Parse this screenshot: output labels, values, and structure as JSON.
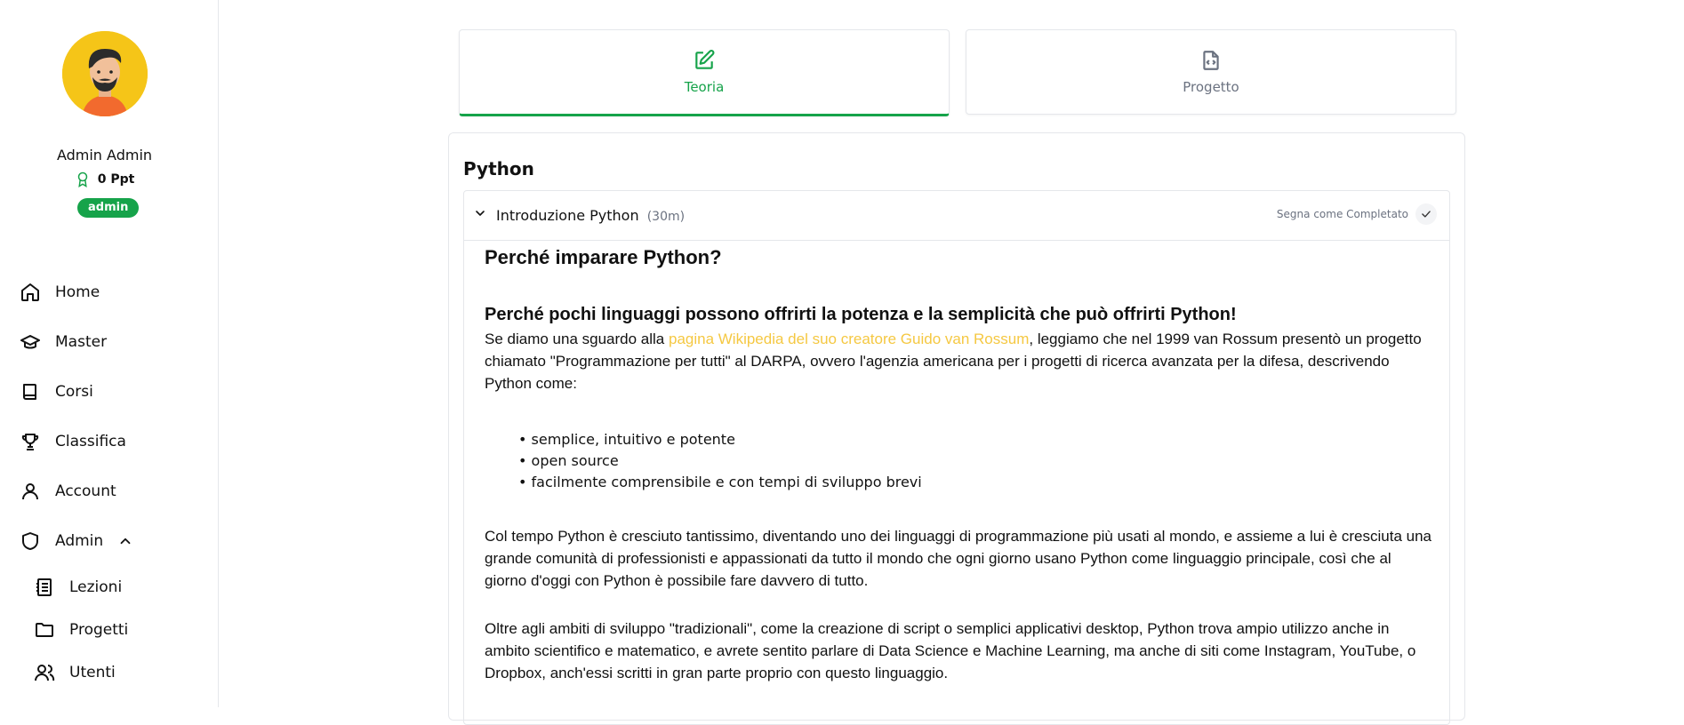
{
  "user": {
    "name": "Admin Admin",
    "points": "0 Ppt",
    "role": "admin"
  },
  "sidebar": {
    "items": [
      {
        "label": "Home",
        "icon": "home-icon"
      },
      {
        "label": "Master",
        "icon": "graduation-cap-icon"
      },
      {
        "label": "Corsi",
        "icon": "book-icon"
      },
      {
        "label": "Classifica",
        "icon": "trophy-icon"
      },
      {
        "label": "Account",
        "icon": "user-icon"
      },
      {
        "label": "Admin",
        "icon": "shield-icon"
      }
    ],
    "admin_subitems": [
      {
        "label": "Lezioni",
        "icon": "list-icon"
      },
      {
        "label": "Progetti",
        "icon": "folder-icon"
      },
      {
        "label": "Utenti",
        "icon": "users-icon"
      }
    ]
  },
  "tabs": [
    {
      "label": "Teoria",
      "icon": "edit-icon",
      "active": true
    },
    {
      "label": "Progetto",
      "icon": "file-code-icon",
      "active": false
    }
  ],
  "main": {
    "section_title": "Python",
    "lesson": {
      "title": "Introduzione Python",
      "duration": "(30m)",
      "mark_complete": "Segna come Completato",
      "heading1": "Perché imparare Python?",
      "heading2": "Perché pochi linguaggi possono offrirti la potenza e la semplicità che può offrirti Python!",
      "para1_before": "Se diamo una sguardo alla ",
      "para1_link": "pagina Wikipedia del suo creatore Guido van Rossum",
      "para1_after": ", leggiamo che nel 1999 van Rossum presentò un progetto chiamato \"Programmazione per tutti\" al DARPA, ovvero l'agenzia americana per i progetti di ricerca avanzata per la difesa, descrivendo Python come:",
      "bullets": [
        "semplice, intuitivo e potente",
        "open source",
        "facilmente comprensibile e con tempi di sviluppo brevi"
      ],
      "para2": "Col tempo Python è cresciuto tantissimo, diventando uno dei linguaggi di programmazione più usati al mondo, e assieme a lui è cresciuta una grande comunità di professionisti e appassionati da tutto il mondo che ogni giorno usano Python come linguaggio principale, così che al giorno d'oggi con Python è possibile fare davvero di tutto.",
      "para3": "Oltre agli ambiti di sviluppo \"tradizionali\", come la creazione di script o semplici applicativi desktop, Python trova ampio utilizzo anche in ambito scientifico e matematico, e avrete sentito parlare di Data Science e Machine Learning, ma anche di siti come Instagram, YouTube, o Dropbox, anch'essi scritti in gran parte proprio con questo linguaggio."
    }
  },
  "colors": {
    "accent": "#16a34a",
    "link": "#f5c842",
    "avatar_bg": "#f5c518"
  }
}
